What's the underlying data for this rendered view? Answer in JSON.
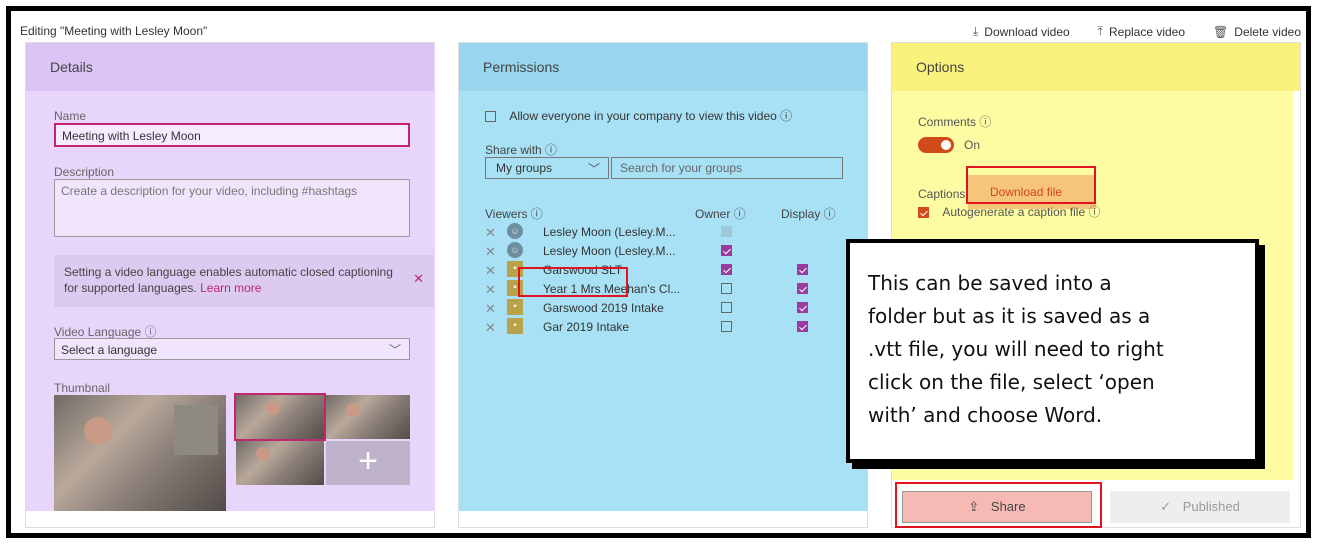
{
  "page": {
    "edit_title": "Editing \"Meeting with Lesley Moon\"",
    "toolbar": {
      "download": "Download video",
      "replace": "Replace video",
      "delete": "Delete video"
    }
  },
  "details": {
    "header": "Details",
    "name_label": "Name",
    "name_value": "Meeting with Lesley Moon",
    "description_label": "Description",
    "description_placeholder": "Create a description for your video, including #hashtags",
    "notice_text": "Setting a video language enables automatic closed captioning for supported languages.",
    "notice_link": "Learn more",
    "language_label": "Video Language ⓘ",
    "language_value": "Select a language",
    "thumbnail_label": "Thumbnail"
  },
  "permissions": {
    "header": "Permissions",
    "allow_everyone": "Allow everyone in your company to view this video ⓘ",
    "share_with_label": "Share with ⓘ",
    "share_dropdown": "My groups",
    "search_placeholder": "Search for your groups",
    "viewers_col": "Viewers ⓘ",
    "owner_col": "Owner ⓘ",
    "display_col": "Display ⓘ",
    "viewers": [
      {
        "name": "Lesley Moon (Lesley.M...",
        "kind": "person",
        "owner": "disabled",
        "display": "none"
      },
      {
        "name": "Lesley Moon (Lesley.M...",
        "kind": "person",
        "owner": "checked",
        "display": "none"
      },
      {
        "name": "Garswood SLT",
        "kind": "group",
        "owner": "checked",
        "display": "checked"
      },
      {
        "name": "Year 1 Mrs Meehan's Cl...",
        "kind": "group",
        "owner": "unchecked",
        "display": "checked"
      },
      {
        "name": "Garswood 2019 Intake",
        "kind": "group",
        "owner": "unchecked",
        "display": "checked"
      },
      {
        "name": "Gar 2019 Intake",
        "kind": "group",
        "owner": "unchecked",
        "display": "checked"
      }
    ]
  },
  "options": {
    "header": "Options",
    "comments_label": "Comments ⓘ",
    "comments_state": "On",
    "captions_label": "Captions",
    "download_file": "Download file",
    "autogen_label": "Autogenerate a caption file ⓘ",
    "share_button": "Share",
    "published_button": "Published"
  },
  "callout": {
    "lines": [
      "This can be saved into a",
      "folder but as it is saved as a",
      ".vtt file, you will need to right",
      "click on the file, select ‘open",
      "with’ and choose Word."
    ]
  },
  "colors": {
    "details_tint": "#e8d5fc",
    "permissions_tint": "#a8e1f5",
    "options_tint": "#fdfca2",
    "accent": "#c2266f",
    "highlight_box": "#e0141e"
  }
}
